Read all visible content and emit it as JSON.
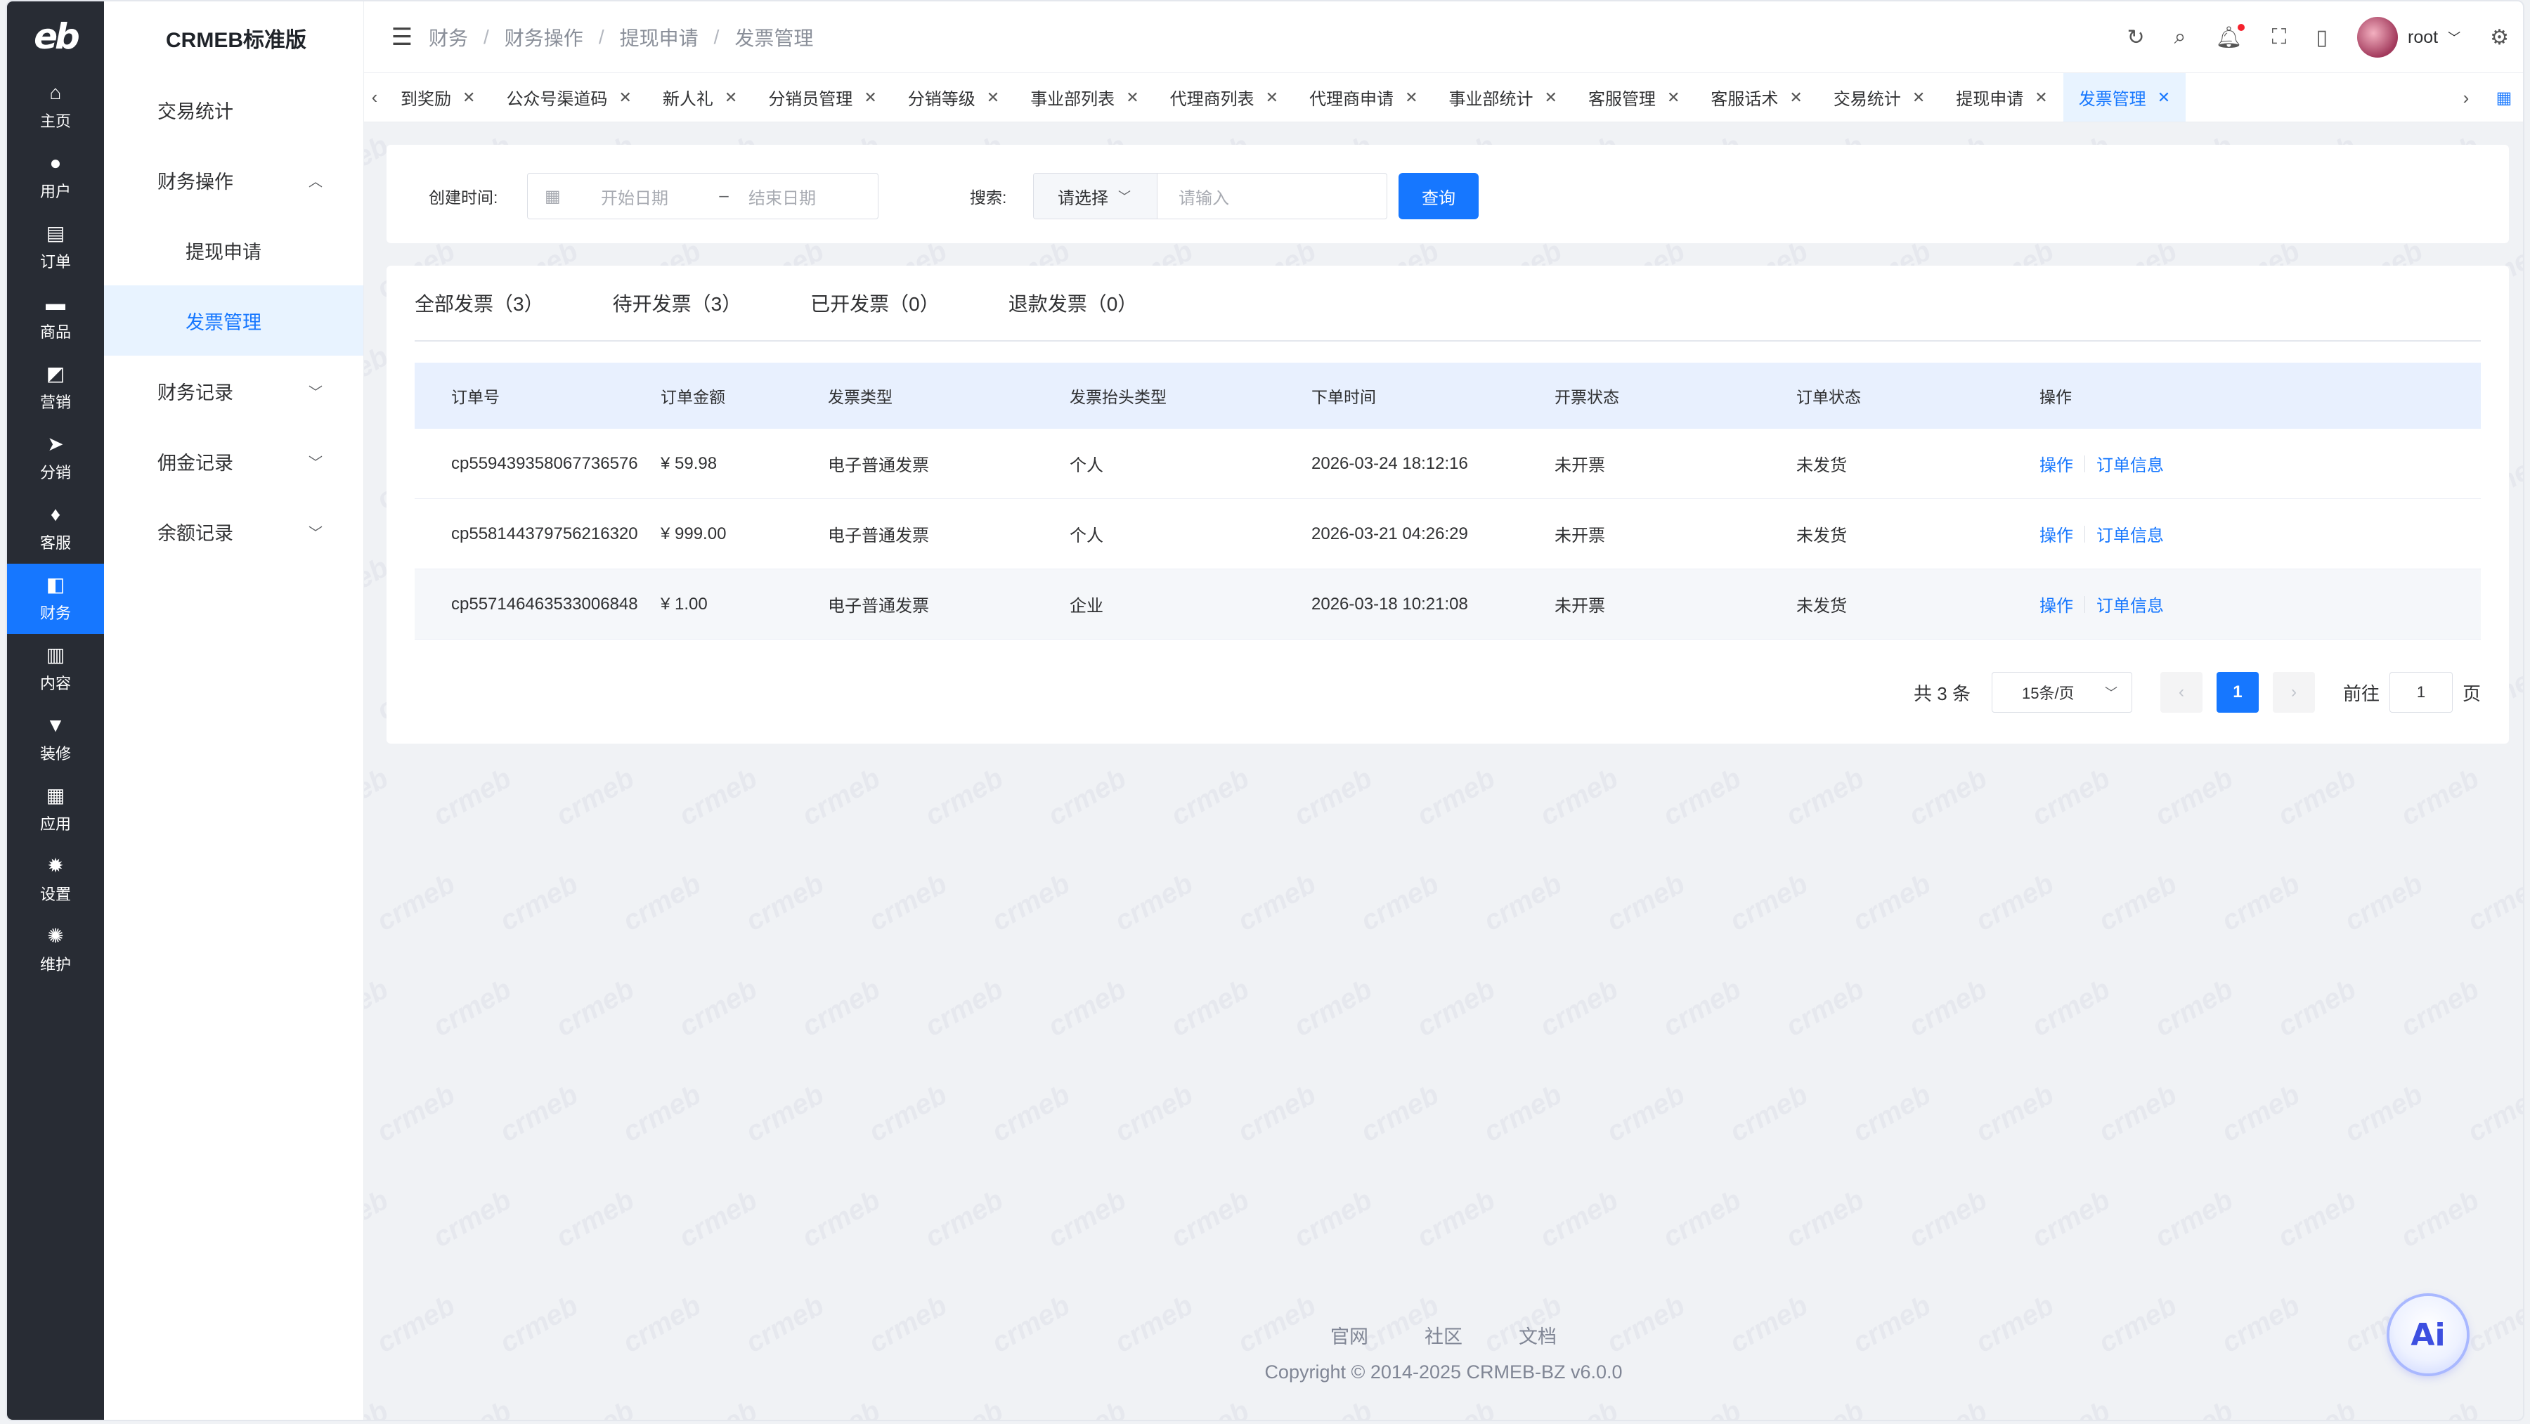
{
  "rail": {
    "logo": "eb",
    "items": [
      {
        "icon": "home-icon",
        "glyph": "⌂",
        "label": "主页"
      },
      {
        "icon": "user-icon",
        "glyph": "●",
        "label": "用户"
      },
      {
        "icon": "order-icon",
        "glyph": "▤",
        "label": "订单"
      },
      {
        "icon": "product-icon",
        "glyph": "▬",
        "label": "商品"
      },
      {
        "icon": "marketing-icon",
        "glyph": "◩",
        "label": "营销"
      },
      {
        "icon": "distribution-icon",
        "glyph": "➤",
        "label": "分销"
      },
      {
        "icon": "service-icon",
        "glyph": "♦",
        "label": "客服"
      },
      {
        "icon": "finance-icon",
        "glyph": "◧",
        "label": "财务",
        "active": true
      },
      {
        "icon": "content-icon",
        "glyph": "▥",
        "label": "内容"
      },
      {
        "icon": "decorate-icon",
        "glyph": "▼",
        "label": "装修"
      },
      {
        "icon": "apps-icon",
        "glyph": "▦",
        "label": "应用"
      },
      {
        "icon": "settings-icon",
        "glyph": "✹",
        "label": "设置"
      },
      {
        "icon": "maintain-icon",
        "glyph": "✺",
        "label": "维护"
      }
    ]
  },
  "submenu": {
    "brand": "CRMEB标准版",
    "items": [
      {
        "label": "交易统计"
      },
      {
        "label": "财务操作",
        "chevron": "︿"
      },
      {
        "label": "提现申请",
        "sub": true
      },
      {
        "label": "发票管理",
        "sub": true,
        "active": true
      },
      {
        "label": "财务记录",
        "chevron": "﹀"
      },
      {
        "label": "佣金记录",
        "chevron": "﹀"
      },
      {
        "label": "余额记录",
        "chevron": "﹀"
      }
    ]
  },
  "header": {
    "breadcrumbs": [
      "财务",
      "财务操作",
      "提现申请",
      "发票管理"
    ],
    "username": "root"
  },
  "tags": [
    {
      "label": "到奖励"
    },
    {
      "label": "公众号渠道码"
    },
    {
      "label": "新人礼"
    },
    {
      "label": "分销员管理"
    },
    {
      "label": "分销等级"
    },
    {
      "label": "事业部列表"
    },
    {
      "label": "代理商列表"
    },
    {
      "label": "代理商申请"
    },
    {
      "label": "事业部统计"
    },
    {
      "label": "客服管理"
    },
    {
      "label": "客服话术"
    },
    {
      "label": "交易统计"
    },
    {
      "label": "提现申请"
    },
    {
      "label": "发票管理",
      "active": true
    }
  ],
  "filter": {
    "created_label": "创建时间:",
    "start_placeholder": "开始日期",
    "range_sep": "–",
    "end_placeholder": "结束日期",
    "search_label": "搜索:",
    "select_value": "请选择",
    "input_placeholder": "请输入",
    "query_button": "查询"
  },
  "tabs": [
    "全部发票（3）",
    "待开发票（3）",
    "已开发票（0）",
    "退款发票（0）"
  ],
  "table": {
    "columns": [
      "订单号",
      "订单金额",
      "发票类型",
      "发票抬头类型",
      "下单时间",
      "开票状态",
      "订单状态",
      "操作"
    ],
    "rows": [
      {
        "order_no": "cp559439358067736576",
        "amount": "¥ 59.98",
        "invoice_type": "电子普通发票",
        "header_type": "个人",
        "time": "2026-03-24 18:12:16",
        "invoice_status": "未开票",
        "order_status": "未发货",
        "op1": "操作",
        "op2": "订单信息"
      },
      {
        "order_no": "cp558144379756216320",
        "amount": "¥ 999.00",
        "invoice_type": "电子普通发票",
        "header_type": "个人",
        "time": "2026-03-21 04:26:29",
        "invoice_status": "未开票",
        "order_status": "未发货",
        "op1": "操作",
        "op2": "订单信息"
      },
      {
        "order_no": "cp557146463533006848",
        "amount": "¥ 1.00",
        "invoice_type": "电子普通发票",
        "header_type": "企业",
        "time": "2026-03-18 10:21:08",
        "invoice_status": "未开票",
        "order_status": "未发货",
        "op1": "操作",
        "op2": "订单信息"
      }
    ]
  },
  "pager": {
    "total": "共 3 条",
    "page_size": "15条/页",
    "current_page": "1",
    "goto_label": "前往",
    "goto_value": "1",
    "page_unit": "页"
  },
  "footer": {
    "links": [
      "官网",
      "社区",
      "文档"
    ],
    "copyright": "Copyright © 2014-2025 CRMEB-BZ v6.0.0"
  },
  "ai_button": "Ai",
  "watermark": "crmeb",
  "colors": {
    "primary": "#1677ff",
    "rail": "#282c34"
  }
}
